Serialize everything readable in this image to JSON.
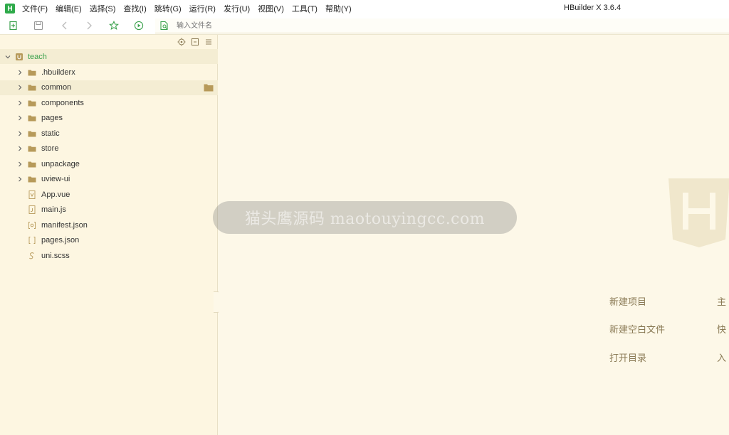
{
  "menubar": {
    "logo": "H",
    "items": [
      "文件(F)",
      "编辑(E)",
      "选择(S)",
      "查找(I)",
      "跳转(G)",
      "运行(R)",
      "发行(U)",
      "视图(V)",
      "工具(T)",
      "帮助(Y)"
    ],
    "title": "HBuilder X 3.6.4"
  },
  "toolbar": {
    "icons": [
      "new-file-icon",
      "save-icon",
      "back-icon",
      "forward-icon",
      "star-icon",
      "run-icon",
      "file-search-icon"
    ],
    "filename_placeholder": "输入文件名"
  },
  "sidebar": {
    "tools": [
      "locate-icon",
      "collapse-all-icon",
      "menu-icon"
    ],
    "project": "teach",
    "items": [
      {
        "label": ".hbuilderx",
        "type": "folder"
      },
      {
        "label": "common",
        "type": "folder"
      },
      {
        "label": "components",
        "type": "folder"
      },
      {
        "label": "pages",
        "type": "folder"
      },
      {
        "label": "static",
        "type": "folder"
      },
      {
        "label": "store",
        "type": "folder"
      },
      {
        "label": "unpackage",
        "type": "folder"
      },
      {
        "label": "uview-ui",
        "type": "folder"
      },
      {
        "label": "App.vue",
        "type": "vue"
      },
      {
        "label": "main.js",
        "type": "js"
      },
      {
        "label": "manifest.json",
        "type": "manifest"
      },
      {
        "label": "pages.json",
        "type": "json"
      },
      {
        "label": "uni.scss",
        "type": "scss"
      }
    ]
  },
  "main": {
    "logo_letter": "H",
    "actions_left": [
      "新建项目",
      "新建空白文件",
      "打开目录"
    ],
    "actions_right": [
      "主",
      "快",
      "入"
    ]
  },
  "watermark": "猫头鹰源码 maotouyingcc.com",
  "colors": {
    "accent_green": "#3aa14c",
    "folder": "#b79a5a",
    "sidebar_bg": "#fdf6e1",
    "main_bg": "#fdf8e8"
  }
}
